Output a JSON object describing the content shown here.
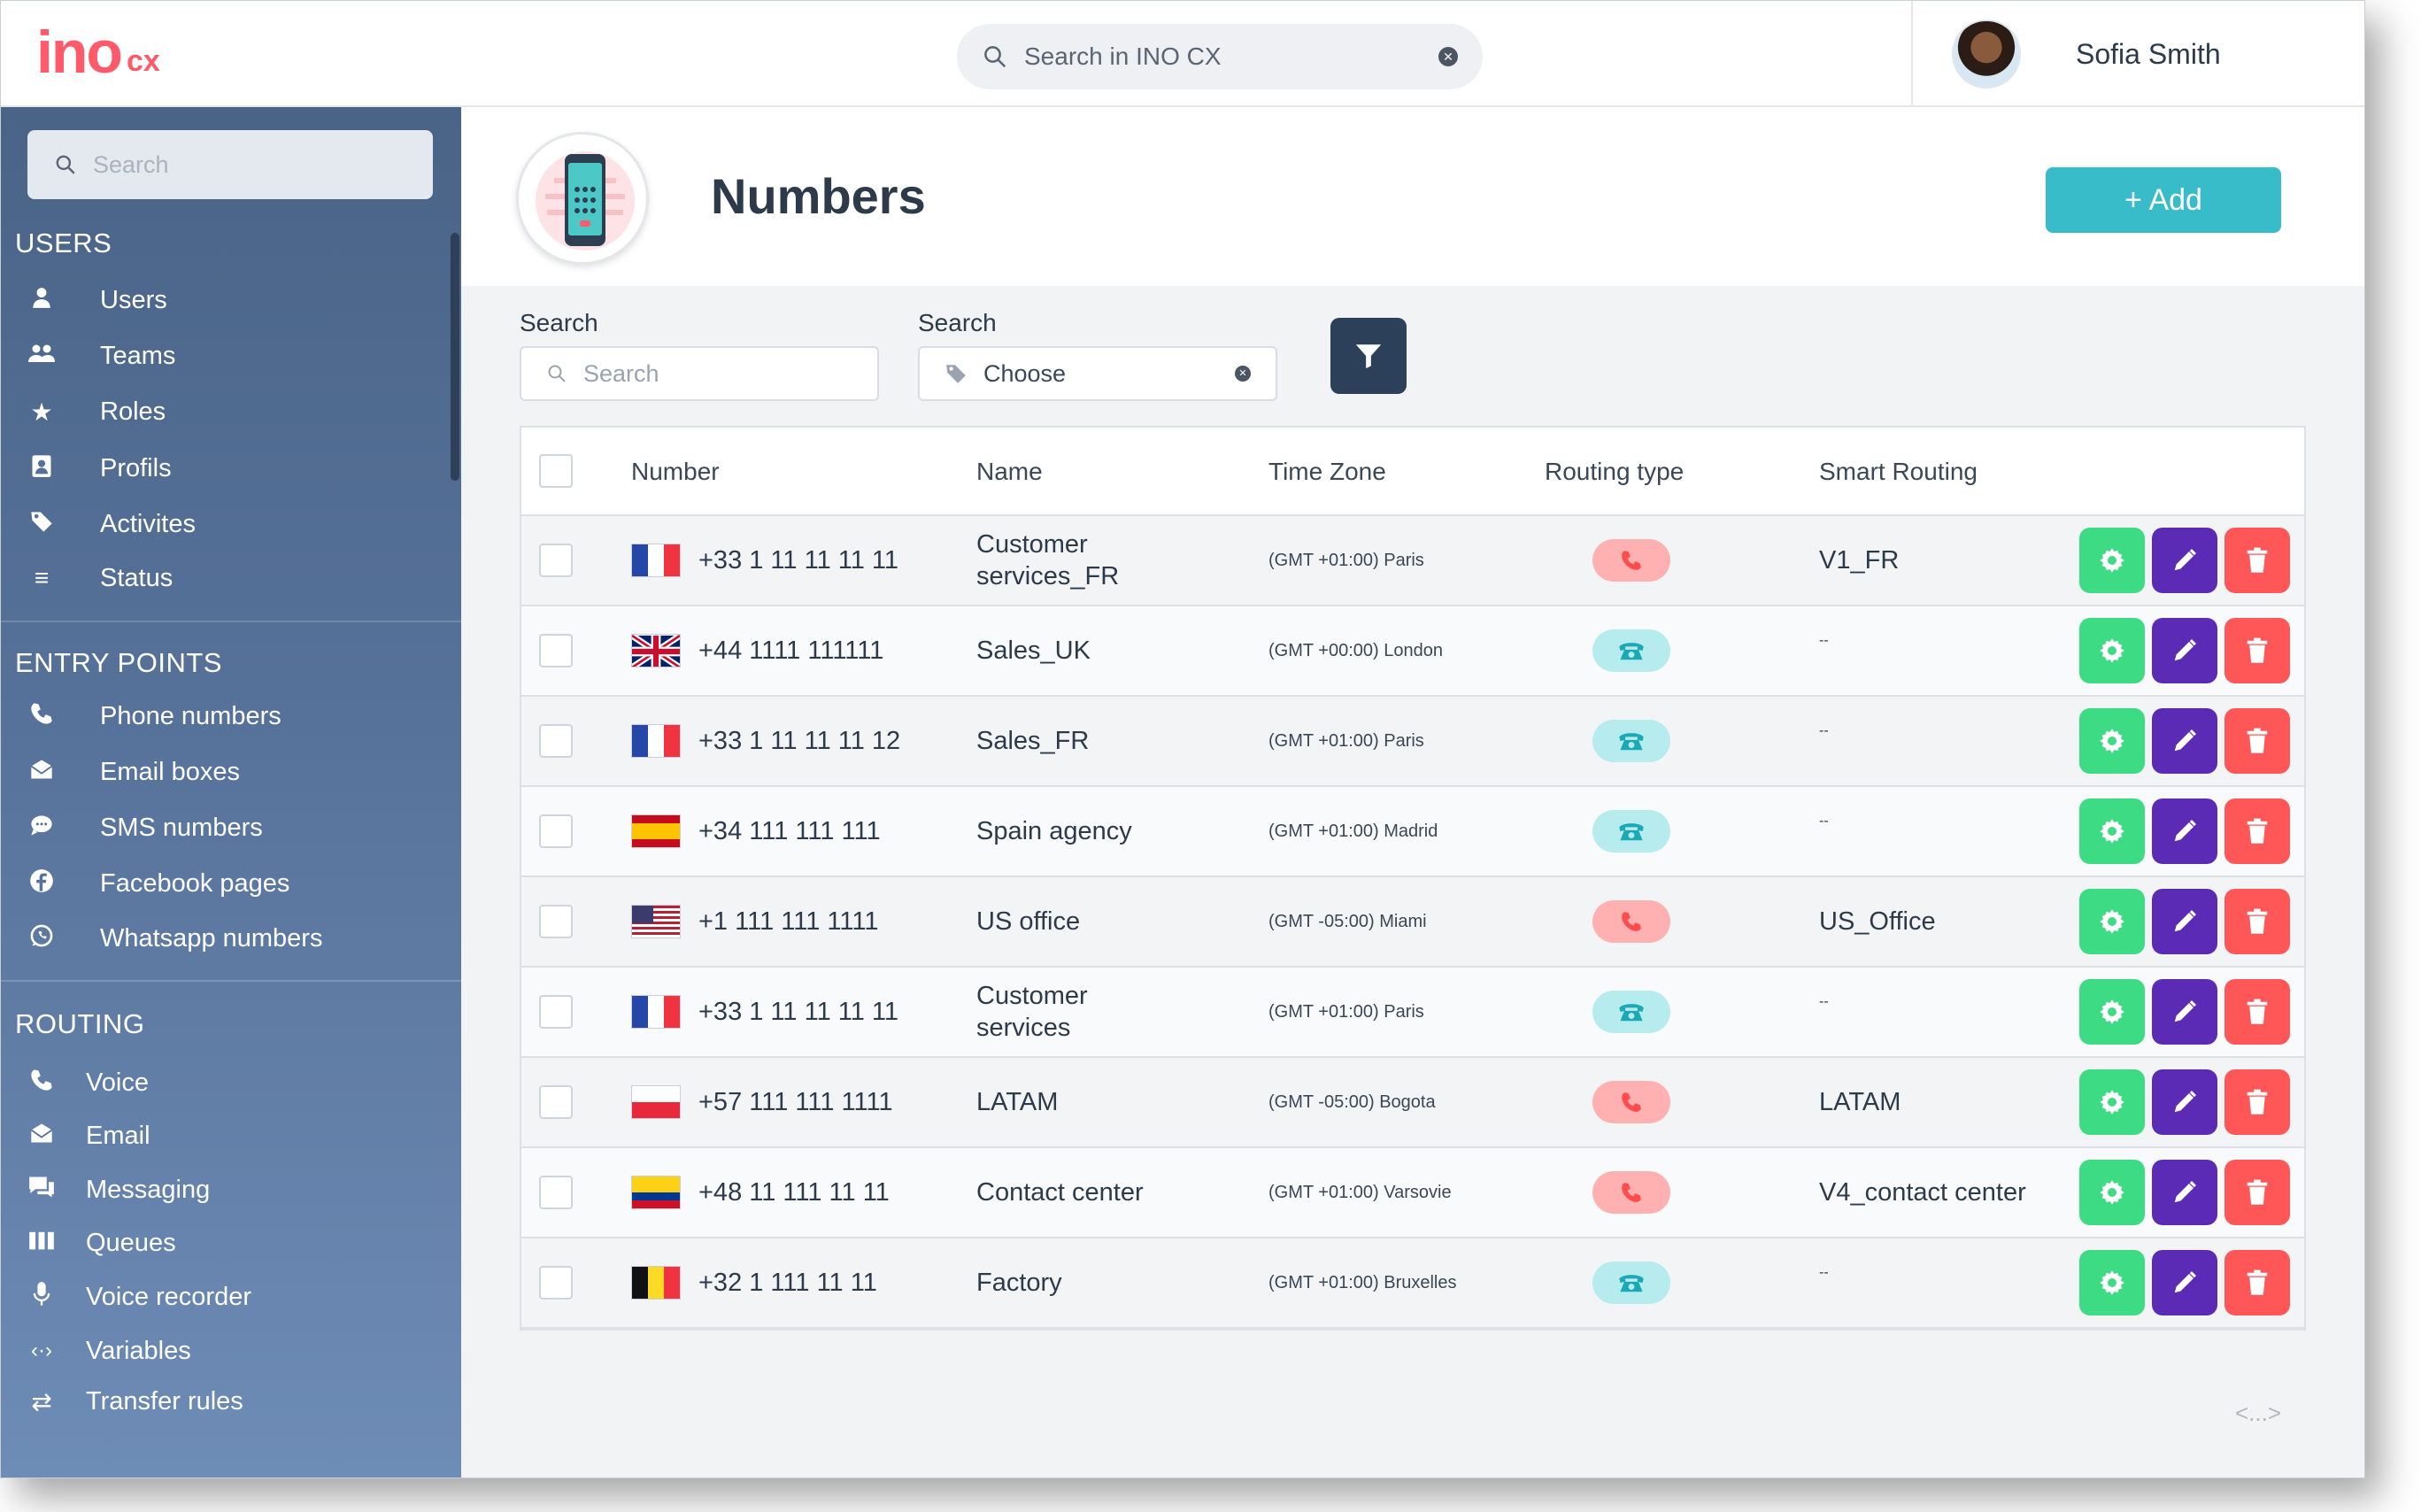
{
  "app": {
    "logo_main": "ino",
    "logo_sub": "cx"
  },
  "topbar": {
    "search_placeholder": "Search in INO CX",
    "user_name": "Sofia Smith"
  },
  "sidebar": {
    "search_placeholder": "Search",
    "sections": [
      {
        "title": "USERS",
        "items": [
          {
            "label": "Users",
            "icon": "user-icon"
          },
          {
            "label": "Teams",
            "icon": "team-icon"
          },
          {
            "label": "Roles",
            "icon": "star-icon"
          },
          {
            "label": "Profils",
            "icon": "profile-icon"
          },
          {
            "label": "Activites",
            "icon": "tag-icon"
          },
          {
            "label": "Status",
            "icon": "list-icon"
          }
        ]
      },
      {
        "title": "ENTRY POINTS",
        "items": [
          {
            "label": "Phone numbers",
            "icon": "phone-icon"
          },
          {
            "label": "Email boxes",
            "icon": "mailbox-icon"
          },
          {
            "label": "SMS numbers",
            "icon": "chat-icon"
          },
          {
            "label": "Facebook pages",
            "icon": "facebook-icon"
          },
          {
            "label": "Whatsapp numbers",
            "icon": "whatsapp-icon"
          }
        ]
      },
      {
        "title": "ROUTING",
        "items": [
          {
            "label": "Voice",
            "icon": "phone-icon"
          },
          {
            "label": "Email",
            "icon": "mailbox-icon"
          },
          {
            "label": "Messaging",
            "icon": "messaging-icon"
          },
          {
            "label": "Queues",
            "icon": "queues-icon"
          },
          {
            "label": "Voice recorder",
            "icon": "microphone-icon"
          },
          {
            "label": "Variables",
            "icon": "variables-icon"
          },
          {
            "label": "Transfer rules",
            "icon": "transfer-icon"
          }
        ]
      }
    ]
  },
  "page": {
    "title": "Numbers",
    "add_label": "+ Add",
    "filter1_label": "Search",
    "filter1_placeholder": "Search",
    "filter2_label": "Search",
    "filter2_value": "Choose",
    "pager": "<...>"
  },
  "table": {
    "columns": [
      "Number",
      "Name",
      "Time Zone",
      "Routing type",
      "Smart Routing"
    ],
    "rows": [
      {
        "flag": "fr",
        "number": "+33 1 11 11 11 11",
        "name": "Customer services_FR",
        "tz": "(GMT +01:00) Paris",
        "routing": "red",
        "smart": "V1_FR"
      },
      {
        "flag": "uk",
        "number": "+44 1111 111111",
        "name": "Sales_UK",
        "tz": "(GMT +00:00) London",
        "routing": "teal",
        "smart": "--"
      },
      {
        "flag": "fr",
        "number": "+33 1 11 11 11 12",
        "name": "Sales_FR",
        "tz": "(GMT +01:00) Paris",
        "routing": "teal",
        "smart": "--"
      },
      {
        "flag": "es",
        "number": "+34 111 111 111",
        "name": "Spain agency",
        "tz": "(GMT +01:00) Madrid",
        "routing": "teal",
        "smart": "--"
      },
      {
        "flag": "us",
        "number": "+1 111 111 1111",
        "name": "US office",
        "tz": "(GMT -05:00) Miami",
        "routing": "red",
        "smart": "US_Office"
      },
      {
        "flag": "fr",
        "number": "+33 1 11 11 11 11",
        "name": "Customer services",
        "tz": "(GMT +01:00) Paris",
        "routing": "teal",
        "smart": "--"
      },
      {
        "flag": "pl",
        "number": "+57 111 111 1111",
        "name": "LATAM",
        "tz": "(GMT -05:00) Bogota",
        "routing": "red",
        "smart": "LATAM"
      },
      {
        "flag": "co",
        "number": "+48 11 111 11 11",
        "name": "Contact center",
        "tz": "(GMT +01:00) Varsovie",
        "routing": "red",
        "smart": "V4_contact center"
      },
      {
        "flag": "be",
        "number": "+32 1 111 11 11",
        "name": "Factory",
        "tz": "(GMT +01:00) Bruxelles",
        "routing": "teal",
        "smart": "--"
      }
    ]
  },
  "colors": {
    "accent": "#39bcc9",
    "brand": "#ff5a6a",
    "sidebar": "#57729a",
    "settings": "#3ddc84",
    "edit": "#5b2bb5",
    "delete": "#ff5757"
  }
}
